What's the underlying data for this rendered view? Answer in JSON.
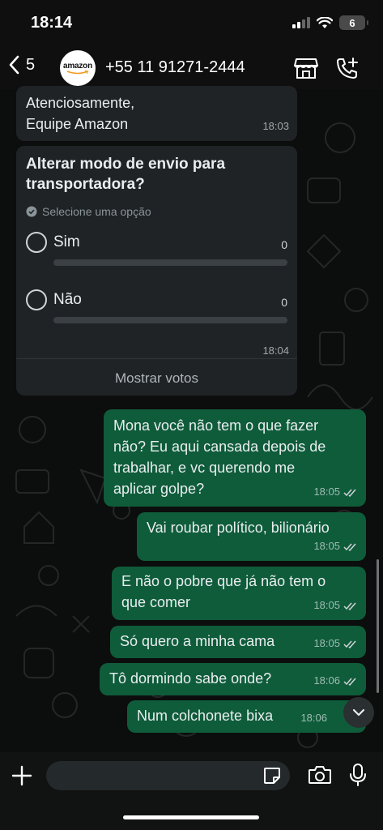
{
  "status_bar": {
    "time": "18:14",
    "battery": "6"
  },
  "header": {
    "back_count": "5",
    "avatar_text": "amazon",
    "contact_name": "+55 11 91271-2444"
  },
  "messages": [
    {
      "direction": "in",
      "text": "Atenciosamente,\nEquipe Amazon",
      "time": "18:03"
    },
    {
      "direction": "in",
      "type": "poll",
      "poll": {
        "title": "Alterar modo de envio para transportadora?",
        "hint": "Selecione uma opção",
        "options": [
          {
            "label": "Sim",
            "votes": "0"
          },
          {
            "label": "Não",
            "votes": "0"
          }
        ],
        "show_votes": "Mostrar votos"
      },
      "time": "18:04"
    },
    {
      "direction": "out",
      "text": "Mona você não tem o que fazer\nnão? Eu aqui cansada depois de\ntrabalhar, e vc querendo me\naplicar golpe?",
      "time": "18:05"
    },
    {
      "direction": "out",
      "text": "Vai roubar político, bilionário",
      "time": "18:05"
    },
    {
      "direction": "out",
      "text": "E não o pobre que já não tem o\nque comer",
      "time": "18:05"
    },
    {
      "direction": "out",
      "text": "Só quero a minha cama",
      "time": "18:05"
    },
    {
      "direction": "out",
      "text": "Tô dormindo sabe onde?",
      "time": "18:06"
    },
    {
      "direction": "out",
      "text": "Num colchonete bixa",
      "time": "18:06"
    }
  ],
  "composer": {
    "input_value": "",
    "placeholder": ""
  },
  "icons": {
    "back": "chevron-left-icon",
    "store": "store-icon",
    "add_call": "add-call-icon",
    "plus": "plus-icon",
    "sticker": "sticker-icon",
    "camera": "camera-icon",
    "mic": "microphone-icon",
    "scroll_down": "chevron-down-icon",
    "read_receipt": "double-check-icon"
  },
  "colors": {
    "incoming_bubble": "#1f2325",
    "outgoing_bubble": "#0f5c3b",
    "background": "#0c0d0d"
  }
}
